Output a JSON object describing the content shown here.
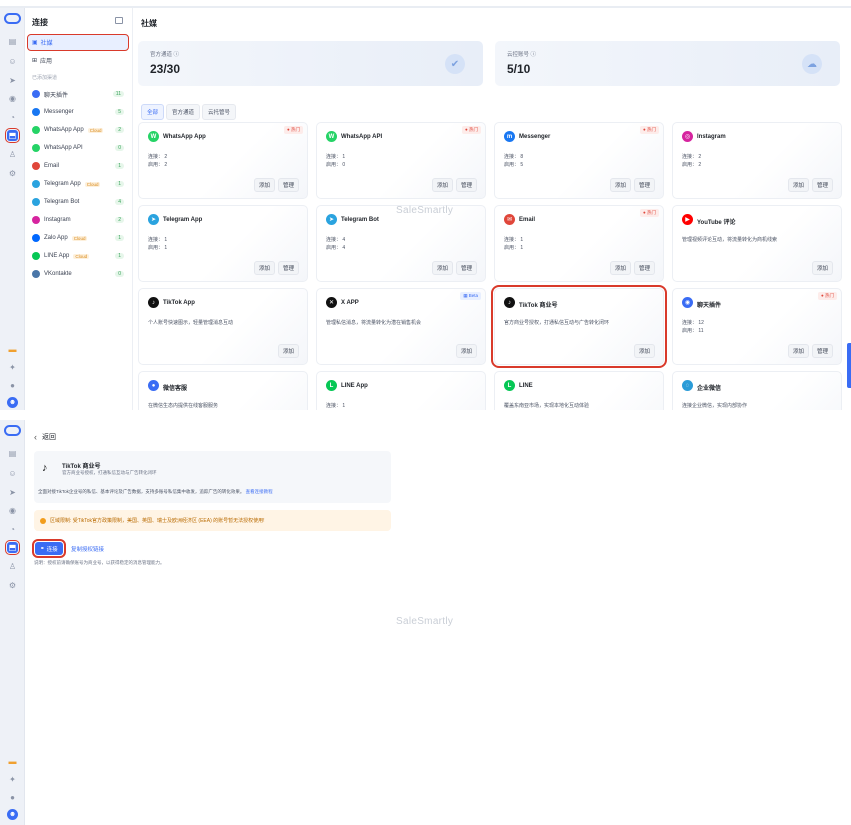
{
  "brand": {
    "accent": "#3a6cf4",
    "highlight": "#d93a2b"
  },
  "rail_icons": [
    "logo-icon",
    "chat-icon",
    "contacts-icon",
    "send-icon",
    "circle-icon",
    "chart-icon",
    "connect-icon",
    "robot-icon",
    "settings-icon"
  ],
  "rail_bottom_icons": [
    "gift-icon",
    "bell-icon",
    "help-icon",
    "user-avatar-icon"
  ],
  "sidebar": {
    "title": "连接",
    "items": [
      {
        "label": "社媒",
        "icon": "social-icon"
      },
      {
        "label": "应用",
        "icon": "app-icon"
      }
    ],
    "section_label": "已添加渠道",
    "channels": [
      {
        "label": "聊天插件",
        "count": "11",
        "color": "#3a6cf4",
        "cloud": ""
      },
      {
        "label": "Messenger",
        "count": "5",
        "color": "#1877f2",
        "cloud": ""
      },
      {
        "label": "WhatsApp App",
        "count": "2",
        "color": "#25d366",
        "cloud": "Cloud"
      },
      {
        "label": "WhatsApp API",
        "count": "0",
        "color": "#25d366",
        "cloud": ""
      },
      {
        "label": "Email",
        "count": "1",
        "color": "#e0463a",
        "cloud": ""
      },
      {
        "label": "Telegram App",
        "count": "1",
        "color": "#2aa3df",
        "cloud": "Cloud"
      },
      {
        "label": "Telegram Bot",
        "count": "4",
        "color": "#2aa3df",
        "cloud": ""
      },
      {
        "label": "Instagram",
        "count": "2",
        "color": "#d6249f",
        "cloud": ""
      },
      {
        "label": "Zalo App",
        "count": "1",
        "color": "#0068ff",
        "cloud": "Cloud"
      },
      {
        "label": "LINE App",
        "count": "1",
        "color": "#06c755",
        "cloud": "Cloud"
      },
      {
        "label": "VKontakte",
        "count": "0",
        "color": "#4a76a8",
        "cloud": ""
      }
    ]
  },
  "main": {
    "title": "社媒",
    "quota": [
      {
        "label": "官方通道 ⓘ",
        "value": "23/30"
      },
      {
        "label": "云控账号 ⓘ",
        "value": "5/10"
      }
    ],
    "tabs": [
      "全部",
      "官方通道",
      "云托管号"
    ],
    "watermark": "SaleSmartly",
    "hot_label": "热门",
    "beta_label": "Beta",
    "add_label": "添加",
    "manage_label": "管理",
    "connected_label": "连接：",
    "used_label": "启用：",
    "cards": [
      {
        "name": "WhatsApp App",
        "icon": "whatsapp-icon",
        "color": "#25d366",
        "glyph": "W",
        "hot": true,
        "connected": "2",
        "used": "2"
      },
      {
        "name": "WhatsApp API",
        "icon": "whatsapp-icon",
        "color": "#25d366",
        "glyph": "W",
        "hot": true,
        "connected": "1",
        "used": "0"
      },
      {
        "name": "Messenger",
        "icon": "messenger-icon",
        "color": "#1877f2",
        "glyph": "m",
        "hot": true,
        "connected": "8",
        "used": "5"
      },
      {
        "name": "Instagram",
        "icon": "instagram-icon",
        "color": "#d6249f",
        "glyph": "◎",
        "hot": false,
        "connected": "2",
        "used": "2"
      },
      {
        "name": "Telegram App",
        "icon": "telegram-icon",
        "color": "#2aa3df",
        "glyph": "➤",
        "hot": false,
        "connected": "1",
        "used": "1"
      },
      {
        "name": "Telegram Bot",
        "icon": "telegram-icon",
        "color": "#2aa3df",
        "glyph": "➤",
        "hot": false,
        "connected": "4",
        "used": "4"
      },
      {
        "name": "Email",
        "icon": "email-icon",
        "color": "#e0463a",
        "glyph": "✉",
        "hot": true,
        "connected": "1",
        "used": "1"
      },
      {
        "name": "YouTube 评论",
        "icon": "youtube-icon",
        "color": "#ff0000",
        "glyph": "▶",
        "hot": false,
        "desc": "管理视频评论互动，将流量转化为商机线索"
      },
      {
        "name": "TikTok App",
        "icon": "tiktok-icon",
        "color": "#111111",
        "glyph": "♪",
        "hot": false,
        "desc": "个人账号快速图示，轻量管理消息互动"
      },
      {
        "name": "X APP",
        "icon": "x-icon",
        "color": "#111111",
        "glyph": "✕",
        "beta": true,
        "desc": "管理私信消息，将流量转化为潜在销售机会"
      },
      {
        "name": "TikTok 商业号",
        "icon": "tiktok-icon",
        "color": "#111111",
        "glyph": "♪",
        "hot": false,
        "desc": "官方商业号授权，打通私信互动与广告转化闭环"
      },
      {
        "name": "聊天插件",
        "icon": "chat-plugin-icon",
        "color": "#3a6cf4",
        "glyph": "◉",
        "hot": true,
        "connected": "12",
        "used": "11"
      },
      {
        "name": "微信客服",
        "icon": "wechat-icon",
        "color": "#3a6cf4",
        "glyph": "●",
        "hot": false,
        "desc": "在微信生态内提供在线客服服务"
      },
      {
        "name": "LINE App",
        "icon": "line-icon",
        "color": "#06c755",
        "glyph": "L",
        "hot": false,
        "connected": "1",
        "used": "1"
      },
      {
        "name": "LINE",
        "icon": "line-icon",
        "color": "#06c755",
        "glyph": "L",
        "hot": false,
        "desc": "覆盖东南亚市场，实现本地化互动体验"
      },
      {
        "name": "企业微信",
        "icon": "wecom-icon",
        "color": "#2b9cd8",
        "glyph": "◌",
        "hot": false,
        "desc": "连接企业微信，实现内部协作"
      }
    ]
  },
  "detail": {
    "back_label": "返回",
    "name": "TikTok 商业号",
    "subtitle": "官方商业号授权，打通私信互动与广告转化闭环",
    "description": "全面对接TikTok企业号的私信、基本评论及广告数据，支持多账号私信集中收发，追踪广告的转化效果。",
    "description_link": "查看连接教程",
    "warning": "区域限制: 受TikTok官方政策限制，美国、英国、瑞士及欧洲经济区 (EEA) 的账号暂无法授权使用!",
    "connect_label": "连接",
    "copy_link_label": "复制授权链接",
    "note": "说明：授权前请确保账号为商业号，以获得稳定的消息管理能力。"
  }
}
